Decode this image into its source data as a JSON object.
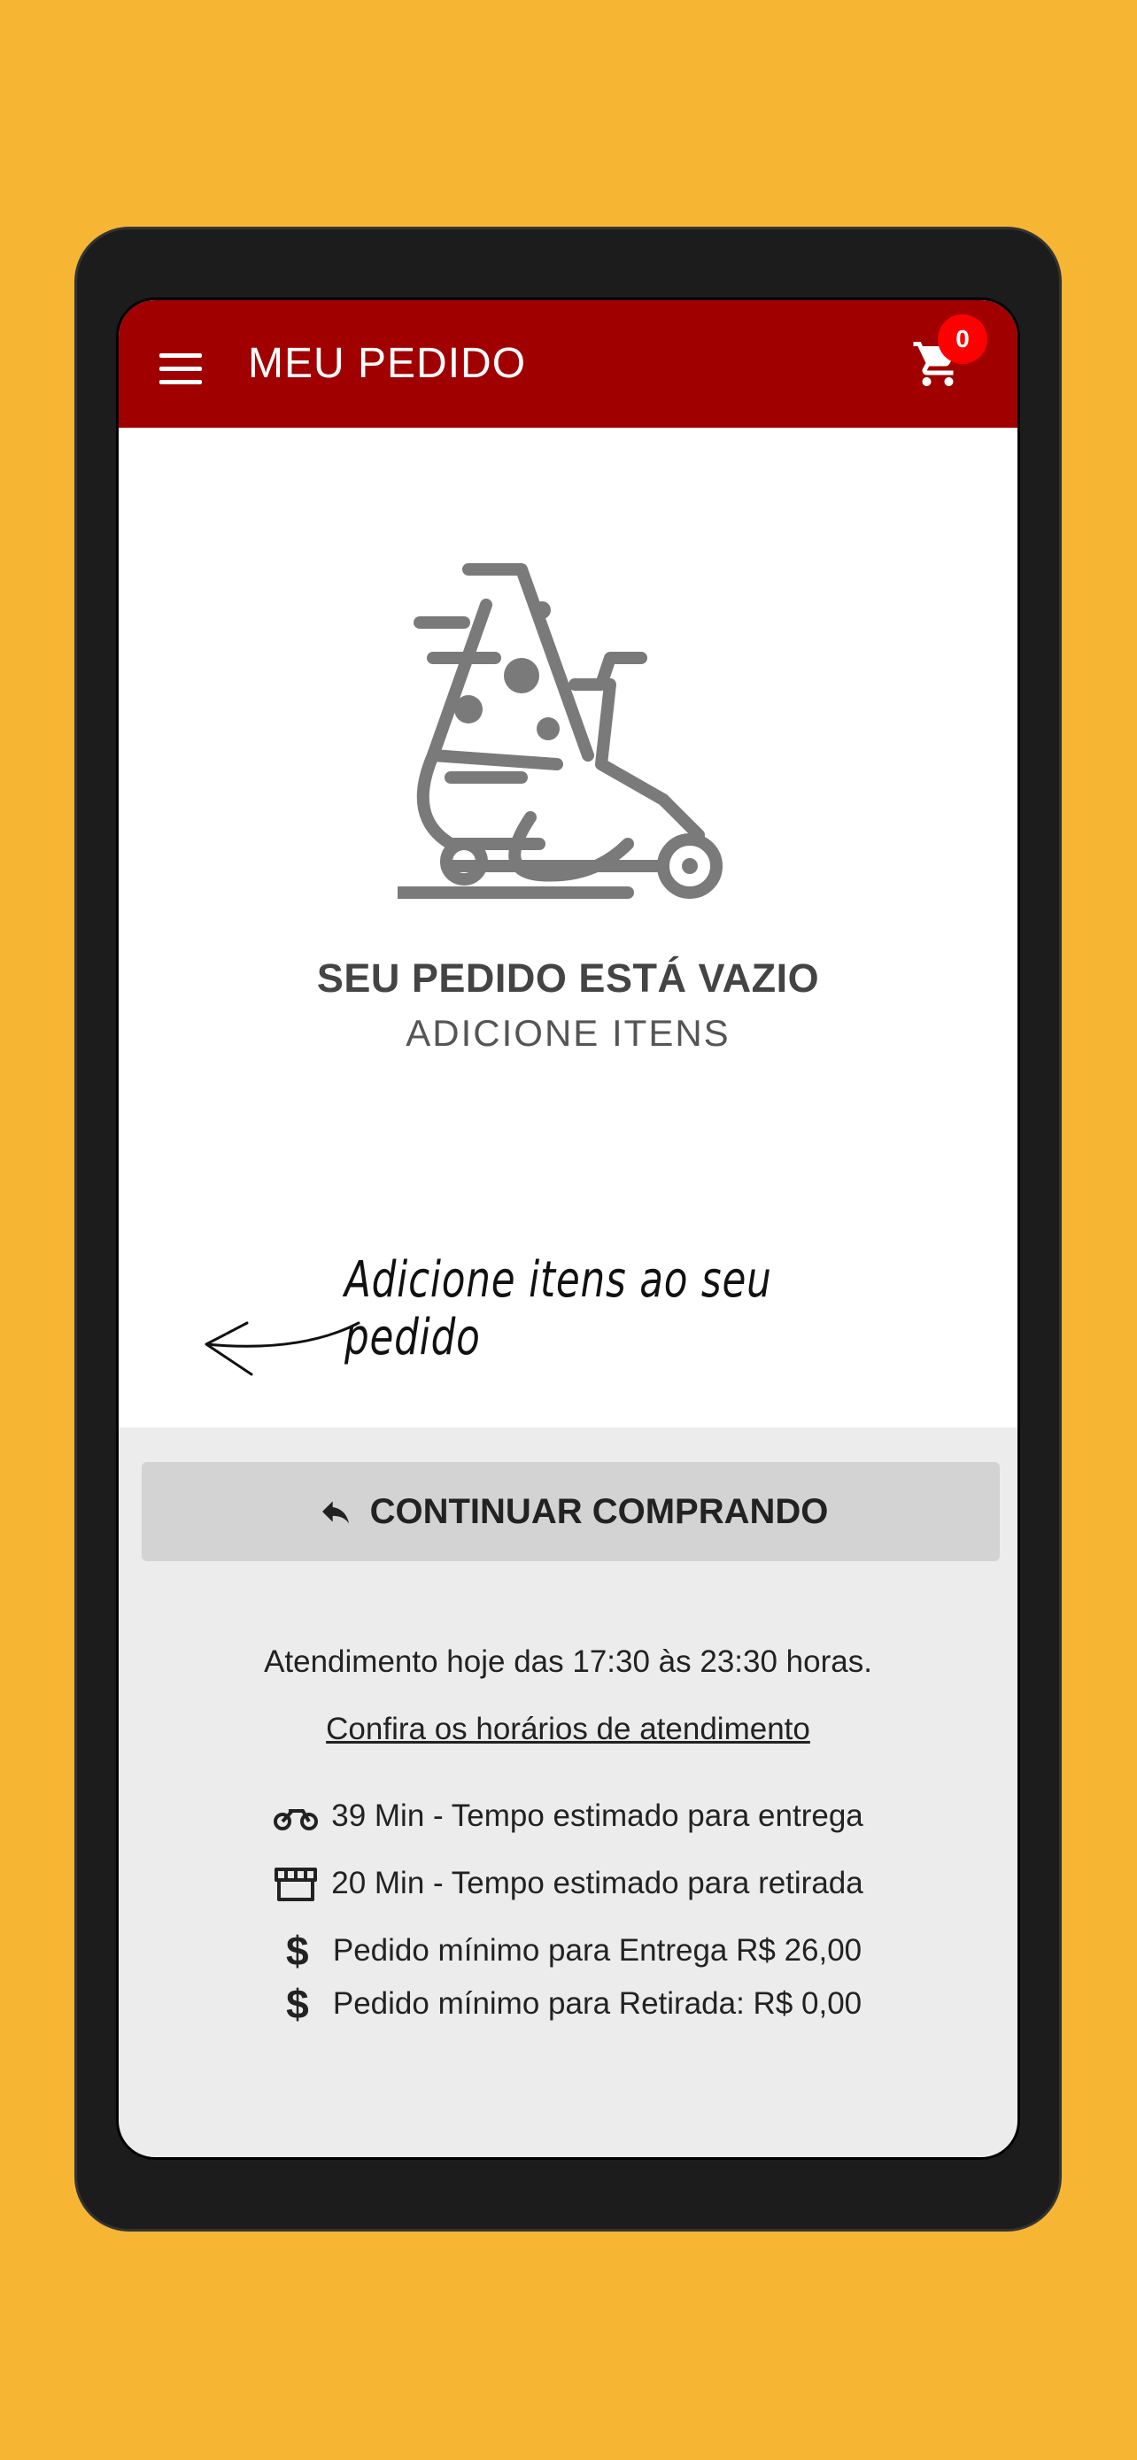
{
  "appbar": {
    "title": "MEU PEDIDO",
    "cart_count": "0",
    "menu_icon": "hamburger-icon",
    "cart_icon": "shopping-cart-icon",
    "color": "#A10000"
  },
  "empty_state": {
    "title": "SEU PEDIDO ESTÁ VAZIO",
    "subtitle": "ADICIONE ITENS",
    "illustration": "pizza-delivery-scooter-icon",
    "hint": "Adicione itens ao seu pedido"
  },
  "actions": {
    "continue_label": "CONTINUAR COMPRANDO",
    "continue_icon": "reply-arrow-icon"
  },
  "info": {
    "hours": "Atendimento hoje das 17:30 às 23:30 horas.",
    "hours_link": "Confira os horários de atendimento",
    "delivery_time": "39 Min - Tempo estimado para entrega",
    "pickup_time": "20 Min - Tempo estimado para retirada",
    "min_delivery": "Pedido mínimo para Entrega R$ 26,00",
    "min_pickup": "Pedido mínimo para Retirada: R$ 0,00"
  },
  "colors": {
    "background": "#F7B534",
    "footer": "#ececec",
    "button": "#d3d3d3",
    "badge": "#ff0000"
  }
}
